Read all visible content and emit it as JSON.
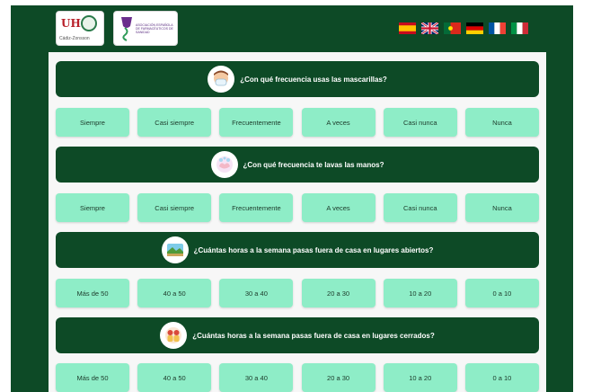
{
  "logos": {
    "left_brand": "UH",
    "left_caption": "Cádiz-Zonsson",
    "right_caption": "ASOCIACIÓN ESPAÑOLA DE FARMACÉUTICOS DE SANIDAD"
  },
  "languages": [
    {
      "code": "es",
      "icon": "flag-spain"
    },
    {
      "code": "en",
      "icon": "flag-uk"
    },
    {
      "code": "pt",
      "icon": "flag-portugal"
    },
    {
      "code": "de",
      "icon": "flag-germany"
    },
    {
      "code": "fr",
      "icon": "flag-france"
    },
    {
      "code": "it",
      "icon": "flag-italy"
    }
  ],
  "questions": [
    {
      "icon": "face-mask-icon",
      "text": "¿Con qué frecuencia usas las mascarillas?",
      "options": [
        "Siempre",
        "Casi siempre",
        "Frecuentemente",
        "A veces",
        "Casi nunca",
        "Nunca"
      ]
    },
    {
      "icon": "hand-wash-icon",
      "text": "¿Con qué frecuencia te lavas las manos?",
      "options": [
        "Siempre",
        "Casi siempre",
        "Frecuentemente",
        "A veces",
        "Casi nunca",
        "Nunca"
      ]
    },
    {
      "icon": "landscape-icon",
      "text": "¿Cuántas horas a la semana pasas fuera de casa en lugares abiertos?",
      "options": [
        "Más de 50",
        "40 a 50",
        "30 a 40",
        "20 a 30",
        "10 a 20",
        "0 a 10"
      ]
    },
    {
      "icon": "people-indoor-icon",
      "text": "¿Cuántas horas a la semana pasas fuera de casa en lugares cerrados?",
      "options": [
        "Más de 50",
        "40 a 50",
        "30 a 40",
        "20 a 30",
        "10 a 20",
        "0 a 10"
      ]
    }
  ]
}
